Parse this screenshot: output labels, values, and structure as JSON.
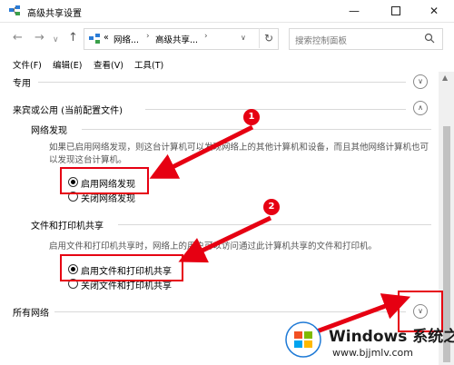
{
  "window": {
    "title": "高级共享设置"
  },
  "navbar": {
    "address": {
      "crumb_prefix": "«",
      "crumb_1": "网络...",
      "crumb_2": "高级共享..."
    },
    "search_placeholder": "搜索控制面板"
  },
  "menu": {
    "items": [
      {
        "label": "文件(F)"
      },
      {
        "label": "编辑(E)"
      },
      {
        "label": "查看(V)"
      },
      {
        "label": "工具(T)"
      }
    ]
  },
  "sections": {
    "private": {
      "label": "专用"
    },
    "guest": {
      "label": "来宾或公用 (当前配置文件)"
    },
    "all": {
      "label": "所有网络"
    }
  },
  "network_discovery": {
    "title": "网络发现",
    "description": "如果已启用网络发现，则这台计算机可以发现网络上的其他计算机和设备，而且其他网络计算机也可以发现这台计算机。",
    "options": [
      {
        "label": "启用网络发现",
        "selected": true
      },
      {
        "label": "关闭网络发现",
        "selected": false
      }
    ]
  },
  "file_printer_sharing": {
    "title": "文件和打印机共享",
    "description": "启用文件和打印机共享时，网络上的用户可以访问通过此计算机共享的文件和打印机。",
    "options": [
      {
        "label": "启用文件和打印机共享",
        "selected": true
      },
      {
        "label": "关闭文件和打印机共享",
        "selected": false
      }
    ]
  },
  "annotations": {
    "badge_1": "1",
    "badge_2": "2",
    "color": "#e60012"
  },
  "watermark": {
    "brand": "Windows",
    "suffix": "系统之家",
    "url": "www.bjjmlv.com"
  }
}
